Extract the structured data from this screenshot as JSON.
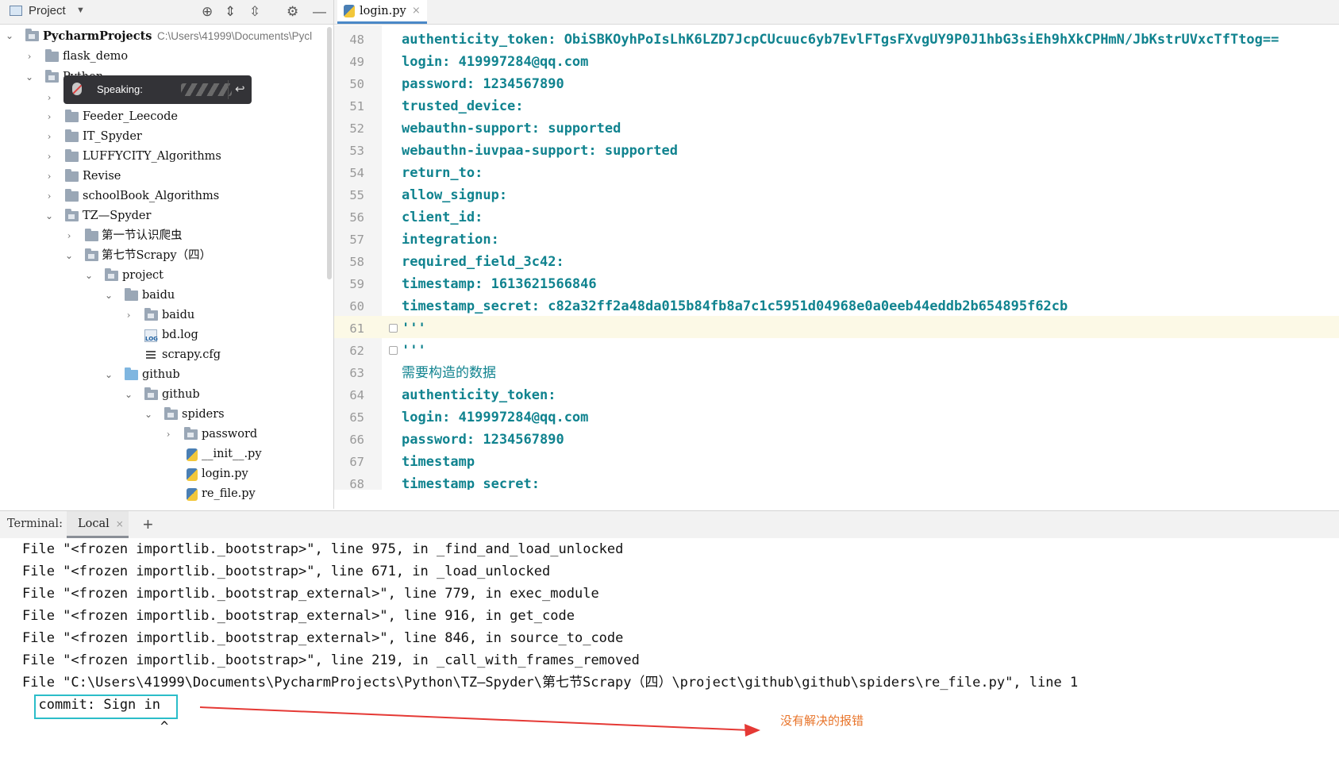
{
  "project_panel": {
    "title": "Project",
    "tree": [
      {
        "label": "PycharmProjects",
        "hint": "C:\\Users\\41999\\Documents\\Pycl"
      },
      {
        "label": "flask_demo"
      },
      {
        "label": "Python"
      },
      {
        "label": ""
      },
      {
        "label": "Feeder_Leecode"
      },
      {
        "label": "IT_Spyder"
      },
      {
        "label": "LUFFYCITY_Algorithms"
      },
      {
        "label": "Revise"
      },
      {
        "label": "schoolBook_Algorithms"
      },
      {
        "label": "TZ—Spyder"
      },
      {
        "label": "第一节认识爬虫"
      },
      {
        "label": "第七节Scrapy（四）"
      },
      {
        "label": "project"
      },
      {
        "label": "baidu"
      },
      {
        "label": "baidu"
      },
      {
        "label": "bd.log"
      },
      {
        "label": "scrapy.cfg"
      },
      {
        "label": "github"
      },
      {
        "label": "github"
      },
      {
        "label": "spiders"
      },
      {
        "label": "password"
      },
      {
        "label": "__init__.py"
      },
      {
        "label": "login.py"
      },
      {
        "label": "re_file.py"
      }
    ]
  },
  "speaking_overlay": {
    "label": "Speaking:"
  },
  "editor": {
    "tab": "login.py",
    "lines": [
      {
        "num": "48",
        "text": "authenticity_token: ObiSBKOyhPoIsLhK6LZD7JcpCUcuuc6yb7EvlFTgsFXvgUY9P0J1hbG3siEh9hXkCPHmN/JbKstrUVxcTfTtog=="
      },
      {
        "num": "49",
        "text": "login: 419997284@qq.com"
      },
      {
        "num": "50",
        "text": "password: 1234567890"
      },
      {
        "num": "51",
        "text": "trusted_device:"
      },
      {
        "num": "52",
        "text": "webauthn-support: supported"
      },
      {
        "num": "53",
        "text": "webauthn-iuvpaa-support: supported"
      },
      {
        "num": "54",
        "text": "return_to:"
      },
      {
        "num": "55",
        "text": "allow_signup:"
      },
      {
        "num": "56",
        "text": "client_id:"
      },
      {
        "num": "57",
        "text": "integration:"
      },
      {
        "num": "58",
        "text": "required_field_3c42:"
      },
      {
        "num": "59",
        "text": "timestamp: 1613621566846"
      },
      {
        "num": "60",
        "text": "timestamp_secret: c82a32ff2a48da015b84fb8a7c1c5951d04968e0a0eeb44eddb2b654895f62cb"
      },
      {
        "num": "61",
        "text": "'''"
      },
      {
        "num": "62",
        "text": "'''"
      },
      {
        "num": "63",
        "text": "需要构造的数据"
      },
      {
        "num": "64",
        "text": "authenticity_token:"
      },
      {
        "num": "65",
        "text": "login: 419997284@qq.com"
      },
      {
        "num": "66",
        "text": "password: 1234567890"
      },
      {
        "num": "67",
        "text": "timestamp"
      },
      {
        "num": "68",
        "text": "timestamp_secret:"
      }
    ]
  },
  "terminal": {
    "label": "Terminal:",
    "tab": "Local",
    "add_label": "+",
    "lines": [
      "File \"<frozen importlib._bootstrap>\", line 975, in _find_and_load_unlocked",
      "File \"<frozen importlib._bootstrap>\", line 671, in _load_unlocked",
      "File \"<frozen importlib._bootstrap_external>\", line 779, in exec_module",
      "File \"<frozen importlib._bootstrap_external>\", line 916, in get_code",
      "File \"<frozen importlib._bootstrap_external>\", line 846, in source_to_code",
      "File \"<frozen importlib._bootstrap>\", line 219, in _call_with_frames_removed",
      "File \"C:\\Users\\41999\\Documents\\PycharmProjects\\Python\\TZ—Spyder\\第七节Scrapy（四）\\project\\github\\github\\spiders\\re_file.py\", line 1",
      "  commit: Sign in",
      "                 ^"
    ]
  },
  "annotation": {
    "note": "没有解决的报错",
    "color": "#e8742a",
    "box_color": "#2bbdc9"
  }
}
